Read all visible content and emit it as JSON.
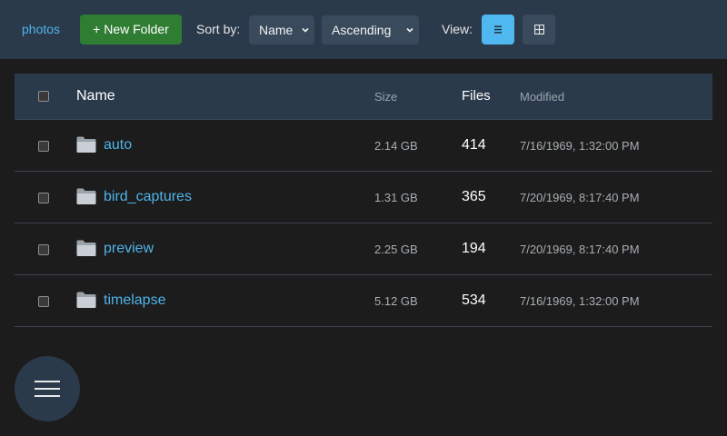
{
  "header": {
    "breadcrumb": "photos",
    "new_folder_label": "+ New Folder",
    "sort_label": "Sort by:",
    "sort_field": "Name",
    "sort_order": "Ascending",
    "view_label": "View:",
    "view_mode": "list",
    "list_view_icon": "list-icon",
    "grid_view_icon": "grid-icon"
  },
  "table": {
    "columns": {
      "name": "Name",
      "size": "Size",
      "files": "Files",
      "modified": "Modified"
    },
    "rows": [
      {
        "name": "auto",
        "size": "2.14 GB",
        "files": "414",
        "modified": "7/16/1969, 1:32:00 PM",
        "icon": "folder-icon"
      },
      {
        "name": "bird_captures",
        "size": "1.31 GB",
        "files": "365",
        "modified": "7/20/1969, 8:17:40 PM",
        "icon": "folder-icon"
      },
      {
        "name": "preview",
        "size": "2.25 GB",
        "files": "194",
        "modified": "7/20/1969, 8:17:40 PM",
        "icon": "folder-icon"
      },
      {
        "name": "timelapse",
        "size": "5.12 GB",
        "files": "534",
        "modified": "7/16/1969, 1:32:00 PM",
        "icon": "folder-icon"
      }
    ]
  },
  "fab": {
    "icon": "hamburger-menu-icon"
  },
  "colors": {
    "accent": "#4fb8f0",
    "link": "#4fb3ea",
    "primary_button": "#2f7d32",
    "header_bg": "#2b3a4b",
    "page_bg": "#1c1c1c"
  }
}
